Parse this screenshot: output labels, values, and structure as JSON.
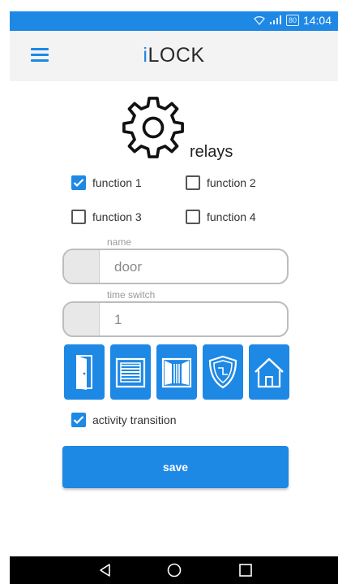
{
  "status_bar": {
    "battery": "80",
    "time": "14:04"
  },
  "app_bar": {
    "title_prefix": "i",
    "title_rest": "LOCK"
  },
  "section": {
    "title": "relays"
  },
  "functions": [
    {
      "label": "function 1",
      "checked": true
    },
    {
      "label": "function 2",
      "checked": false
    },
    {
      "label": "function 3",
      "checked": false
    },
    {
      "label": "function 4",
      "checked": false
    }
  ],
  "fields": {
    "name_label": "name",
    "name_value": "door",
    "time_label": "time switch",
    "time_value": "1"
  },
  "relay_icons": [
    "door-icon",
    "garage-icon",
    "gate-icon",
    "shield-icon",
    "house-icon"
  ],
  "activity": {
    "label": "activity transition",
    "checked": true
  },
  "save_label": "save",
  "colors": {
    "accent": "#1e88e5",
    "statusbar": "#1e88e5",
    "appbar": "#f3f3f3"
  },
  "nav_icons": [
    "back-icon",
    "home-icon",
    "recents-icon"
  ]
}
